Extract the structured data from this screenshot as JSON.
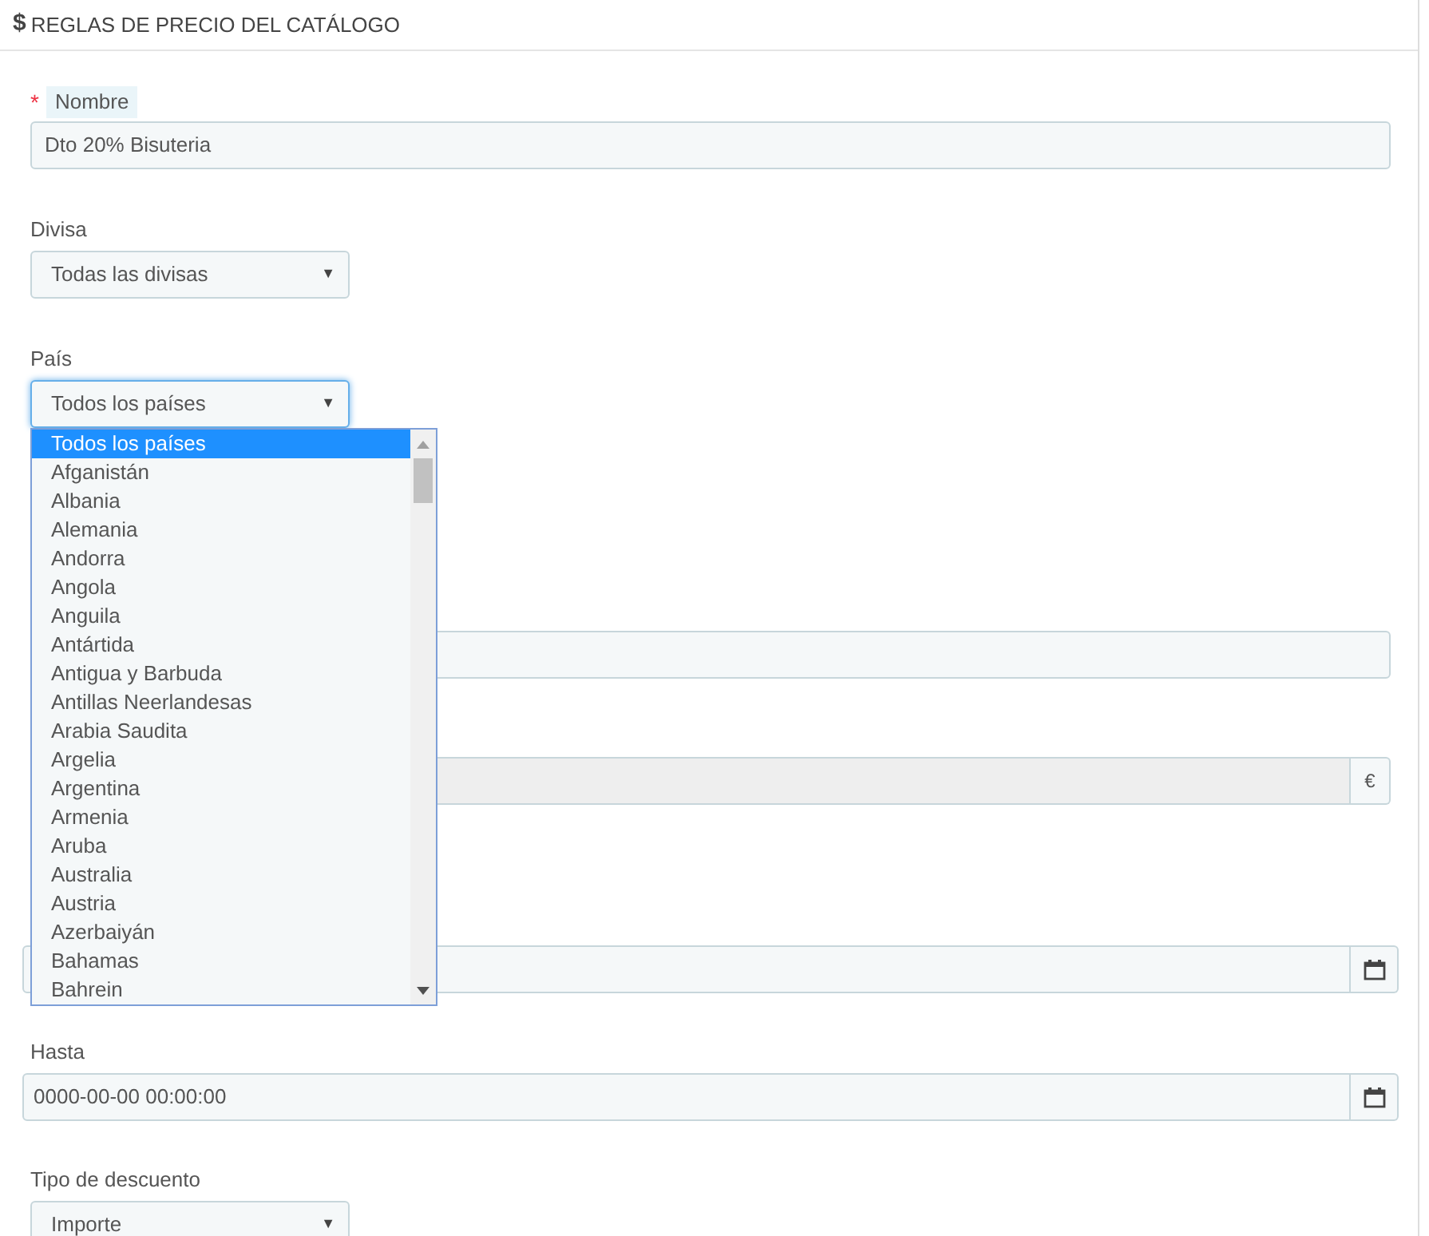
{
  "panel": {
    "title_icon": "$",
    "title": "REGLAS DE PRECIO DEL CATÁLOGO"
  },
  "name_field": {
    "required_mark": "*",
    "label": "Nombre",
    "value": "Dto 20% Bisuteria"
  },
  "currency_field": {
    "label": "Divisa",
    "value": "Todas las divisas",
    "arrow": "▼"
  },
  "country_field": {
    "label": "País",
    "value": "Todos los países",
    "arrow": "▼",
    "expanded": true,
    "options": [
      {
        "label": "Todos los países",
        "selected": true
      },
      {
        "label": "Afganistán",
        "selected": false
      },
      {
        "label": "Albania",
        "selected": false
      },
      {
        "label": "Alemania",
        "selected": false
      },
      {
        "label": "Andorra",
        "selected": false
      },
      {
        "label": "Angola",
        "selected": false
      },
      {
        "label": "Anguila",
        "selected": false
      },
      {
        "label": "Antártida",
        "selected": false
      },
      {
        "label": "Antigua y Barbuda",
        "selected": false
      },
      {
        "label": "Antillas Neerlandesas",
        "selected": false
      },
      {
        "label": "Arabia Saudita",
        "selected": false
      },
      {
        "label": "Argelia",
        "selected": false
      },
      {
        "label": "Argentina",
        "selected": false
      },
      {
        "label": "Armenia",
        "selected": false
      },
      {
        "label": "Aruba",
        "selected": false
      },
      {
        "label": "Australia",
        "selected": false
      },
      {
        "label": "Austria",
        "selected": false
      },
      {
        "label": "Azerbaiyán",
        "selected": false
      },
      {
        "label": "Bahamas",
        "selected": false
      },
      {
        "label": "Bahrein",
        "selected": false
      }
    ]
  },
  "price_field": {
    "addon": "€"
  },
  "to_field": {
    "label": "Hasta",
    "value": "0000-00-00 00:00:00"
  },
  "discount_type_field": {
    "label": "Tipo de descuento",
    "value": "Importe",
    "arrow": "▼"
  }
}
